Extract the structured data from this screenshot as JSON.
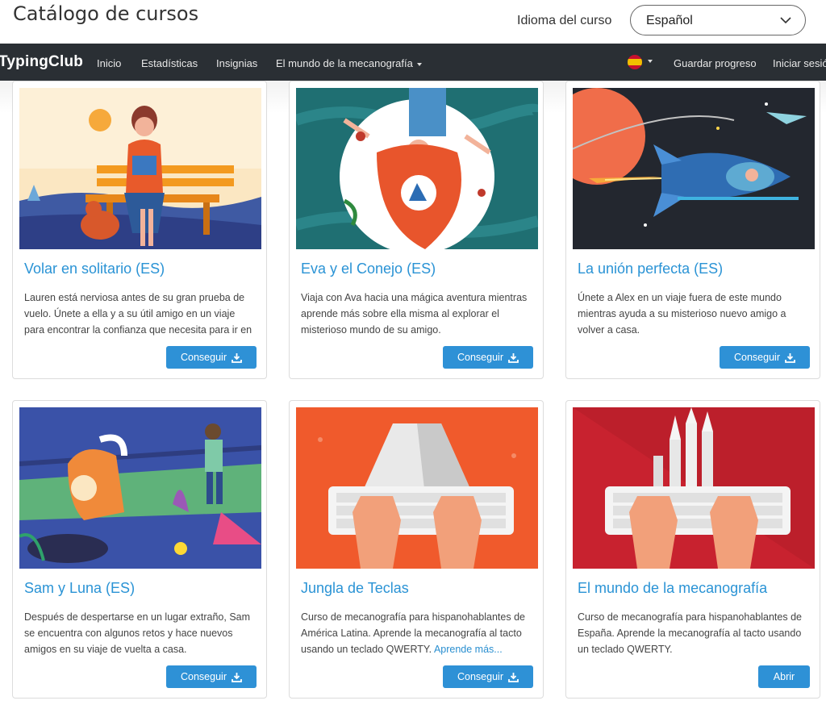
{
  "header": {
    "title": "Catálogo de cursos",
    "language_label": "Idioma del curso",
    "language_value": "Español"
  },
  "navbar": {
    "brand": "TypingClub",
    "items": [
      "Inicio",
      "Estadísticas",
      "Insignias",
      "El mundo de la mecanografía"
    ],
    "save": "Guardar progreso",
    "login": "Iniciar sesión"
  },
  "colors": {
    "accent": "#2e91d6",
    "title_blue": "#2a93d5",
    "navbar": "#2a2f34"
  },
  "cards": [
    {
      "title": "Volar en solitario (ES)",
      "description": "Lauren está nerviosa antes de su gran prueba de vuelo. Únete a ella y a su útil amigo en un viaje para encontrar la confianza que necesita para ir en",
      "button": "Conseguir",
      "button_icon": "download-icon"
    },
    {
      "title": "Eva y el Conejo (ES)",
      "description": "Viaja con Ava hacia una mágica aventura mientras aprende más sobre ella misma al explorar el misterioso mundo de su amigo.",
      "button": "Conseguir",
      "button_icon": "download-icon"
    },
    {
      "title": "La unión perfecta (ES)",
      "description": "Únete a Alex en un viaje fuera de este mundo mientras ayuda a su misterioso nuevo amigo a volver a casa.",
      "button": "Conseguir",
      "button_icon": "download-icon"
    },
    {
      "title": "Sam y Luna (ES)",
      "description": "Después de despertarse en un lugar extraño, Sam se encuentra con algunos retos y hace nuevos amigos en su viaje de vuelta a casa.",
      "button": "Conseguir",
      "button_icon": "download-icon"
    },
    {
      "title": "Jungla de Teclas",
      "description": "Curso de mecanografía para hispanohablantes de América Latina. Aprende la mecanografía al tacto usando un teclado QWERTY.",
      "more": "Aprende más...",
      "button": "Conseguir",
      "button_icon": "download-icon"
    },
    {
      "title": "El mundo de la mecanografía",
      "description": "Curso de mecanografía para hispanohablantes de España. Aprende la mecanografía al tacto usando un teclado QWERTY.",
      "button": "Abrir"
    }
  ]
}
